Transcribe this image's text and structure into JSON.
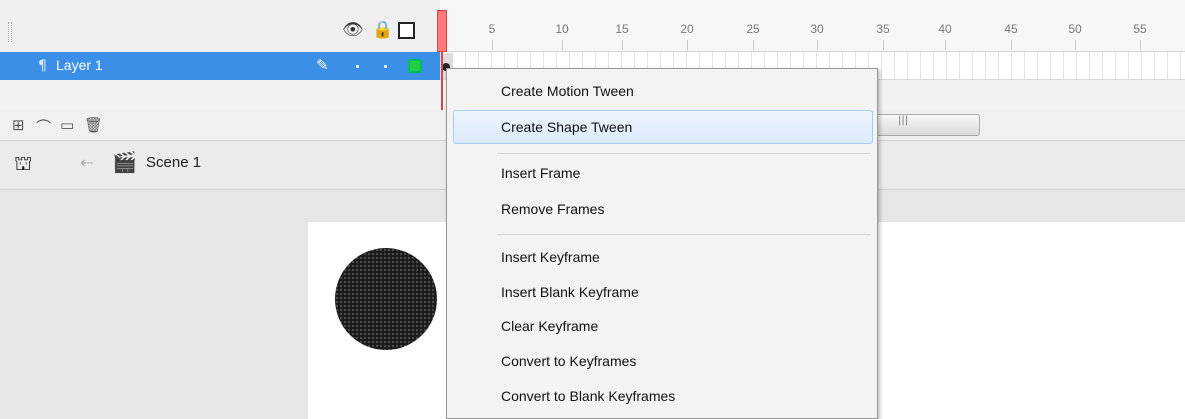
{
  "timeline": {
    "ruler_ticks": [
      "5",
      "10",
      "15",
      "20",
      "25",
      "30",
      "35",
      "40",
      "45",
      "50",
      "55"
    ],
    "layer_name": "Layer 1",
    "layer_color": "#22cc44",
    "selection_color": "#3b8fe6",
    "playhead_color": "#ff7b7b"
  },
  "icons": {
    "eye": "eye-icon",
    "lock": "lock-icon",
    "outline": "outline-square-icon",
    "pencil": "pencil-icon",
    "layer": "layer-icon"
  },
  "edit_bar": {
    "scene_label": "Scene 1"
  },
  "context_menu": {
    "items": [
      "Create Motion Tween",
      "Create Shape Tween",
      "Insert Frame",
      "Remove Frames",
      "Insert Keyframe",
      "Insert Blank Keyframe",
      "Clear Keyframe",
      "Convert to Keyframes",
      "Convert to Blank Keyframes"
    ],
    "highlighted": "Create Shape Tween",
    "accent": "#dbeafb"
  },
  "stage": {
    "shape": "black circle"
  }
}
